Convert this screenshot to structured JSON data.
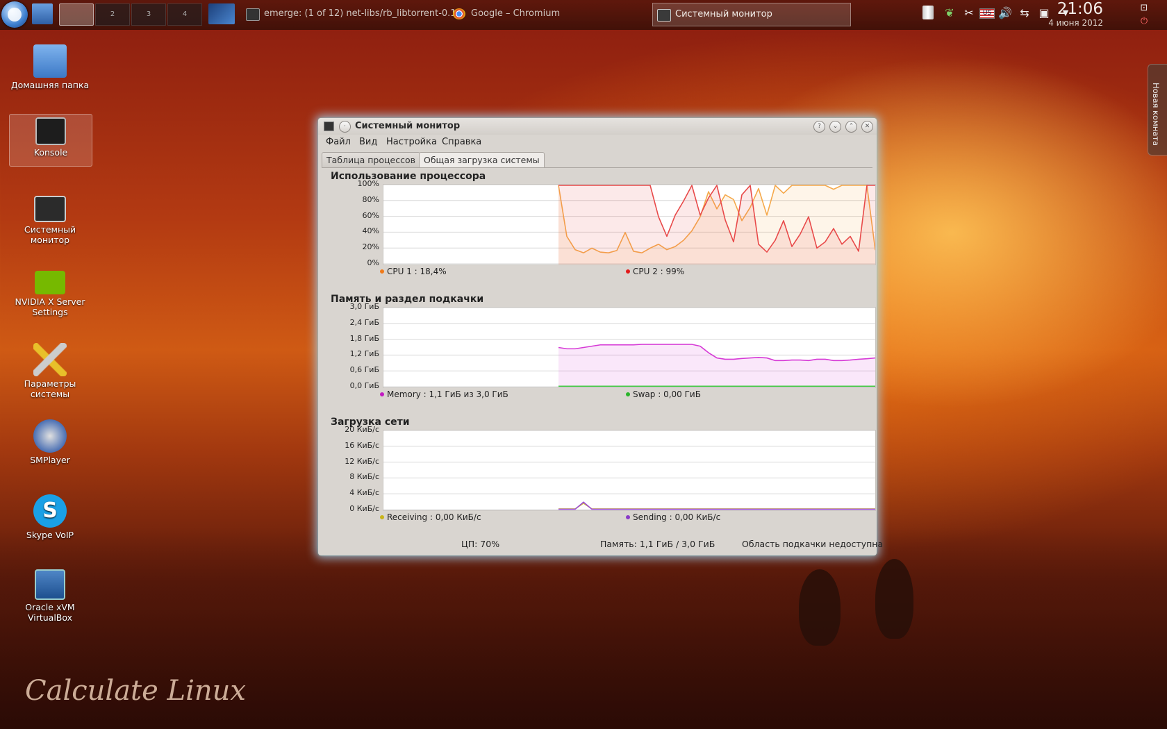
{
  "panel": {
    "pagers": [
      "2",
      "3",
      "4"
    ],
    "tasks": [
      {
        "label": "emerge: (1 of 12) net-libs/rb_libtorrent-0.1…",
        "icon": "terminal-icon"
      },
      {
        "label": "Google – Chromium",
        "icon": "chromium-icon"
      },
      {
        "label": "Системный монитор",
        "icon": "system-monitor-icon",
        "active": true
      }
    ],
    "tray_icons": [
      "trash-icon",
      "leaf-icon",
      "scissors-icon",
      "keyboard-layout-flag-icon",
      "volume-icon",
      "network-icon",
      "battery-icon",
      "tray-expand-icon"
    ],
    "clock": "21:06",
    "date": "4 июня 2012"
  },
  "desktop_icons": [
    {
      "label": "Домашняя папка",
      "icon": "home-folder-icon"
    },
    {
      "label": "Konsole",
      "icon": "konsole-icon",
      "selected": true
    },
    {
      "label": "Системный монитор",
      "icon": "system-monitor-icon"
    },
    {
      "label": "NVIDIA X Server Settings",
      "icon": "nvidia-icon"
    },
    {
      "label": "Параметры системы",
      "icon": "settings-tools-icon"
    },
    {
      "label": "SMPlayer",
      "icon": "smplayer-icon"
    },
    {
      "label": "Skype VoIP",
      "icon": "skype-icon"
    },
    {
      "label": "Oracle xVM VirtualBox",
      "icon": "virtualbox-icon"
    }
  ],
  "activity_tab": "Новая комната",
  "watermark": "Calculate Linux",
  "window": {
    "title": "Системный монитор",
    "menu": [
      "Файл",
      "Вид",
      "Настройка",
      "Справка"
    ],
    "tabs": [
      "Таблица процессов",
      "Общая загрузка системы"
    ],
    "status": {
      "cpu": "ЦП: 70%",
      "memory": "Память: 1,1 ГиБ / 3,0 ГиБ",
      "swap": "Область подкачки недоступна"
    }
  },
  "sections": {
    "cpu": {
      "title": "Использование процессора"
    },
    "mem": {
      "title": "Память и раздел подкачки"
    },
    "net": {
      "title": "Загрузка сети"
    }
  },
  "chart_data": [
    {
      "type": "line",
      "title": "Использование процессора",
      "y_ticks": [
        "100%",
        "80%",
        "60%",
        "40%",
        "20%",
        "0%"
      ],
      "ylim": [
        0,
        100
      ],
      "x_samples": 60,
      "series": [
        {
          "name": "CPU 1",
          "legend": "CPU 1 : 18,4%",
          "color": "#f5a94b",
          "values": [
            null,
            null,
            null,
            null,
            null,
            null,
            null,
            null,
            null,
            null,
            null,
            null,
            null,
            null,
            null,
            null,
            null,
            null,
            null,
            null,
            null,
            100,
            35,
            18,
            14,
            20,
            15,
            14,
            17,
            40,
            16,
            14,
            20,
            25,
            18,
            22,
            30,
            42,
            60,
            92,
            70,
            88,
            82,
            55,
            72,
            96,
            62,
            100,
            90,
            100,
            100,
            100,
            100,
            100,
            95,
            100,
            100,
            100,
            100,
            18,
            14
          ]
        },
        {
          "name": "CPU 2",
          "legend": "CPU 2 : 99%",
          "color": "#e84a4a",
          "values": [
            null,
            null,
            null,
            null,
            null,
            null,
            null,
            null,
            null,
            null,
            null,
            null,
            null,
            null,
            null,
            null,
            null,
            null,
            null,
            null,
            null,
            100,
            100,
            100,
            100,
            100,
            100,
            100,
            100,
            100,
            100,
            100,
            100,
            60,
            35,
            62,
            80,
            100,
            62,
            84,
            100,
            56,
            28,
            88,
            100,
            25,
            15,
            30,
            55,
            22,
            38,
            60,
            20,
            28,
            45,
            25,
            35,
            16,
            100,
            100,
            100
          ]
        }
      ]
    },
    {
      "type": "area",
      "title": "Память и раздел подкачки",
      "y_ticks": [
        "3,0 ГиБ",
        "2,4 ГиБ",
        "1,8 ГиБ",
        "1,2 ГиБ",
        "0,6 ГиБ",
        "0,0 ГиБ"
      ],
      "ylim": [
        0,
        3.0
      ],
      "x_samples": 60,
      "series": [
        {
          "name": "Memory",
          "legend": "Memory : 1,1 ГиБ из 3,0 ГиБ",
          "color": "#d63ad6",
          "values": [
            null,
            null,
            null,
            null,
            null,
            null,
            null,
            null,
            null,
            null,
            null,
            null,
            null,
            null,
            null,
            null,
            null,
            null,
            null,
            null,
            null,
            1.5,
            1.45,
            1.45,
            1.5,
            1.55,
            1.6,
            1.6,
            1.6,
            1.6,
            1.6,
            1.62,
            1.62,
            1.62,
            1.62,
            1.62,
            1.62,
            1.62,
            1.55,
            1.3,
            1.1,
            1.05,
            1.05,
            1.08,
            1.1,
            1.12,
            1.1,
            1.0,
            1.0,
            1.02,
            1.02,
            1.0,
            1.05,
            1.05,
            1.0,
            1.0,
            1.02,
            1.05,
            1.07,
            1.1,
            1.1
          ]
        },
        {
          "name": "Swap",
          "legend": "Swap : 0,00 ГиБ",
          "color": "#3cc83c",
          "values": [
            null,
            null,
            null,
            null,
            null,
            null,
            null,
            null,
            null,
            null,
            null,
            null,
            null,
            null,
            null,
            null,
            null,
            null,
            null,
            null,
            null,
            0.02,
            0.02,
            0.02,
            0.02,
            0.02,
            0.02,
            0.02,
            0.02,
            0.02,
            0.02,
            0.02,
            0.02,
            0.02,
            0.02,
            0.02,
            0.02,
            0.02,
            0.02,
            0.02,
            0.02,
            0.02,
            0.02,
            0.02,
            0.02,
            0.02,
            0.02,
            0.02,
            0.02,
            0.02,
            0.02,
            0.02,
            0.02,
            0.02,
            0.02,
            0.02,
            0.02,
            0.02,
            0.02,
            0.02,
            0.02
          ]
        }
      ]
    },
    {
      "type": "line",
      "title": "Загрузка сети",
      "y_ticks": [
        "20 КиБ/с",
        "16 КиБ/с",
        "12 КиБ/с",
        "8 КиБ/с",
        "4 КиБ/с",
        "0 КиБ/с"
      ],
      "ylim": [
        0,
        20
      ],
      "x_samples": 60,
      "series": [
        {
          "name": "Receiving",
          "legend": "Receiving : 0,00 КиБ/с",
          "color": "#d6c63a",
          "values": [
            null,
            null,
            null,
            null,
            null,
            null,
            null,
            null,
            null,
            null,
            null,
            null,
            null,
            null,
            null,
            null,
            null,
            null,
            null,
            null,
            null,
            0.2,
            0.2,
            0.2,
            1.6,
            0.2,
            0.2,
            0.2,
            0.2,
            0.2,
            0.2,
            0.2,
            0.2,
            0.2,
            0.2,
            0.2,
            0.2,
            0.2,
            0.2,
            0.2,
            0.2,
            0.2,
            0.2,
            0.2,
            0.2,
            0.2,
            0.2,
            0.2,
            0.2,
            0.2,
            0.2,
            0.2,
            0.2,
            0.2,
            0.2,
            0.2,
            0.2,
            0.2,
            0.2,
            0.2,
            0.2
          ]
        },
        {
          "name": "Sending",
          "legend": "Sending : 0,00 КиБ/с",
          "color": "#9a4ad6",
          "values": [
            null,
            null,
            null,
            null,
            null,
            null,
            null,
            null,
            null,
            null,
            null,
            null,
            null,
            null,
            null,
            null,
            null,
            null,
            null,
            null,
            null,
            0.1,
            0.1,
            0.1,
            1.9,
            0.1,
            0.1,
            0.1,
            0.1,
            0.1,
            0.1,
            0.1,
            0.1,
            0.1,
            0.1,
            0.1,
            0.1,
            0.1,
            0.1,
            0.1,
            0.1,
            0.1,
            0.1,
            0.1,
            0.1,
            0.1,
            0.1,
            0.1,
            0.1,
            0.1,
            0.1,
            0.1,
            0.1,
            0.1,
            0.1,
            0.1,
            0.1,
            0.1,
            0.1,
            0.1,
            0.1
          ]
        }
      ]
    }
  ]
}
